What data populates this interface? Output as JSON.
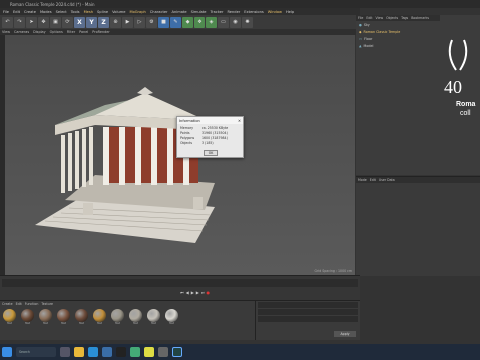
{
  "window": {
    "title": "Roman Classic Temple 2024.c4d (*) - Main"
  },
  "menu": [
    "File",
    "Edit",
    "Create",
    "Modes",
    "Select",
    "Tools",
    "Mesh",
    "Spline",
    "Volume",
    "MoGraph",
    "Character",
    "Animate",
    "Simulate",
    "Tracker",
    "Render",
    "Extensions",
    "Window",
    "Help"
  ],
  "viewport_menu": [
    "View",
    "Cameras",
    "Display",
    "Options",
    "Filter",
    "Panel",
    "ProRender"
  ],
  "viewport": {
    "status": "Grid Spacing : 1000 cm"
  },
  "dialog": {
    "title": "Information",
    "rows": [
      {
        "k": "Memory",
        "v": "ca. 25530 KByte"
      },
      {
        "k": "Points",
        "v": "31960 (315504)"
      },
      {
        "k": "Polygons",
        "v": "1600 (3187984)"
      },
      {
        "k": "Objects",
        "v": "3 (185)"
      }
    ],
    "ok_label": "OK"
  },
  "object_manager": {
    "menu": [
      "File",
      "Edit",
      "View",
      "Objects",
      "Tags",
      "Bookmarks"
    ],
    "objects": [
      "Sky",
      "Roman Classic Temple",
      "Floor",
      "Model"
    ]
  },
  "attribute_manager": {
    "menu": [
      "Mode",
      "Edit",
      "User Data"
    ]
  },
  "logo": {
    "text1": "Roma",
    "text2": "coll"
  },
  "materials": {
    "menu": [
      "Create",
      "Edit",
      "Function",
      "Texture"
    ],
    "items": [
      {
        "label": "Mat",
        "color": "#c99a3b"
      },
      {
        "label": "Mat",
        "color": "#6b4a36"
      },
      {
        "label": "Mat",
        "color": "#8a6e58"
      },
      {
        "label": "Mat",
        "color": "#7a5440"
      },
      {
        "label": "Mat",
        "color": "#6d4b3a"
      },
      {
        "label": "Mat",
        "color": "#c28f3a"
      },
      {
        "label": "Mat",
        "color": "#9a9588"
      },
      {
        "label": "Mat",
        "color": "#b0aba0"
      },
      {
        "label": "Mat",
        "color": "#c4c0b8"
      },
      {
        "label": "Mat",
        "color": "#d8d6d0"
      }
    ]
  },
  "coords": {
    "apply_label": "Apply"
  },
  "taskbar": {
    "search_placeholder": "Search"
  },
  "colors": {
    "accent": "#e8c06a",
    "titlebar": "#2b2b2b",
    "taskbar": "#1f2a3a"
  }
}
